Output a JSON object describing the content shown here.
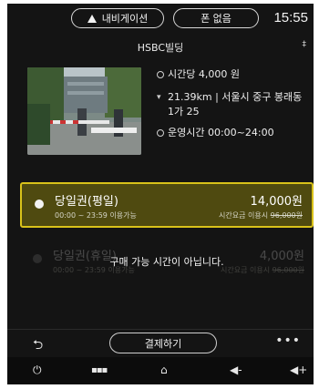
{
  "topbar": {
    "nav_label": "내비게이션",
    "phone_label": "폰 없음",
    "clock": "15:55"
  },
  "title": "HSBC빌딩",
  "info": {
    "rate": "시간당 4,000 원",
    "distance": "21.39km",
    "address_line1": "서울시 중구 봉래동",
    "address_line2": "1가 25",
    "hours": "운영시간 00:00~24:00"
  },
  "options": [
    {
      "name": "당일권(평일)",
      "time": "00:00 ~ 23:59 이용가능",
      "price": "14,000원",
      "note_prefix": "시간요금 이용시 ",
      "note_strike": "96,000원",
      "selected": true
    },
    {
      "name": "당일권(휴일)",
      "time": "00:00 ~ 23:59 이용가능",
      "price": "4,000원",
      "note_prefix": "시간요금 이용시 ",
      "note_strike": "96,000원",
      "selected": false,
      "overlay": "구매 가능 시간이 아닙니다."
    }
  ],
  "actions": {
    "pay_label": "결제하기"
  },
  "colors": {
    "background": "#141414",
    "selected_fill": "#4f4a10",
    "selected_border": "#d9c21a"
  },
  "icons": [
    "navigation-arrow-icon",
    "pin-icon",
    "clock-icon",
    "location-icon",
    "hours-icon",
    "back-icon",
    "more-icon",
    "power-icon",
    "apps-icon",
    "home-icon",
    "volume-down-icon",
    "volume-up-icon"
  ]
}
